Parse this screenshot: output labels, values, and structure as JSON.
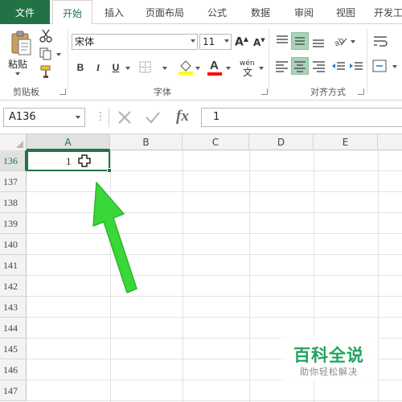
{
  "ribbon_tabs": {
    "file": "文件",
    "home": "开始",
    "insert": "插入",
    "page_layout": "页面布局",
    "formulas": "公式",
    "data": "数据",
    "review": "审阅",
    "view": "视图",
    "developer": "开发工"
  },
  "clipboard": {
    "paste_label": "粘贴",
    "group_label": "剪贴板"
  },
  "font": {
    "font_name": "宋体",
    "font_size": "11",
    "bold": "B",
    "italic": "I",
    "underline": "U",
    "font_color_letter": "A",
    "phonetic": "wén",
    "group_label": "字体",
    "fill_color": "#ffff00",
    "text_color": "#ff0000"
  },
  "alignment": {
    "group_label": "对齐方式"
  },
  "formula_bar": {
    "name_box": "A136",
    "fx_label": "fx",
    "value": "1"
  },
  "sheet": {
    "columns": [
      "A",
      "B",
      "C",
      "D",
      "E"
    ],
    "rows": [
      "136",
      "137",
      "138",
      "139",
      "140",
      "141",
      "142",
      "143",
      "144",
      "145",
      "146",
      "147"
    ],
    "active_cell_value": "1"
  },
  "watermark": {
    "title": "百科全说",
    "subtitle": "助你轻松解决"
  },
  "colors": {
    "accent": "#217346",
    "arrow": "#39d839"
  }
}
